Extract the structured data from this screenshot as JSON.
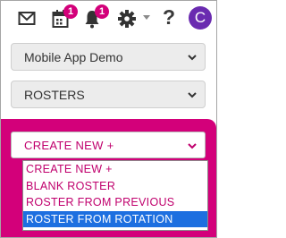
{
  "topbar": {
    "icons": [
      "mail-icon",
      "calendar-icon",
      "bell-icon",
      "gear-icon",
      "help-icon"
    ],
    "calendar_badge": "1",
    "notifications_badge": "1",
    "help_label": "?",
    "avatar_initial": "C"
  },
  "selectors": {
    "account": "Mobile App Demo",
    "section": "ROSTERS"
  },
  "create_menu": {
    "selected": "CREATE NEW +",
    "options": [
      "CREATE NEW +",
      "BLANK ROSTER",
      "ROSTER FROM PREVIOUS",
      "ROSTER FROM ROTATION"
    ],
    "highlighted_option": "ROSTER FROM ROTATION"
  },
  "colors": {
    "accent": "#d3007a",
    "text_accent": "#c0006d",
    "highlight": "#1d6fe0",
    "avatar": "#6a2bb0"
  }
}
